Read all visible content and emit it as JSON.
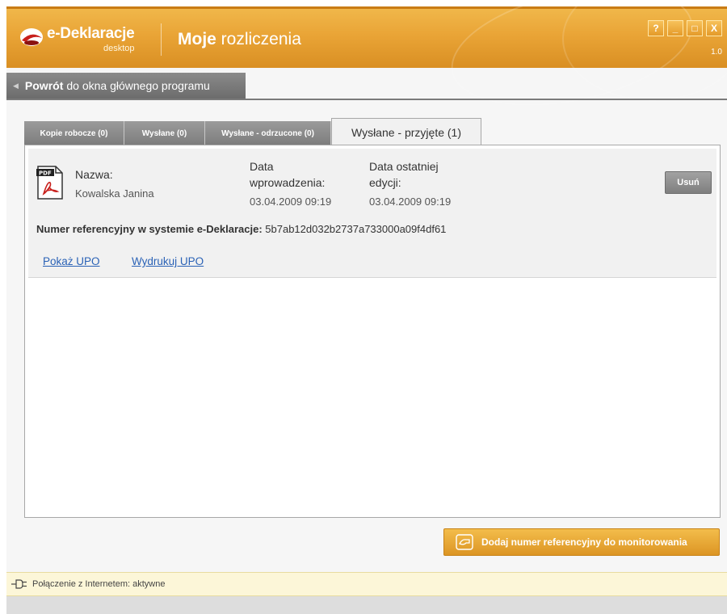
{
  "app": {
    "brand": "e-Deklaracje",
    "brand_sub": "desktop",
    "title_bold": "Moje",
    "title_rest": " rozliczenia",
    "version": "1.0",
    "window_controls": {
      "help": "?",
      "minimize": "_",
      "maximize": "□",
      "close": "X"
    }
  },
  "back": {
    "bold": "Powrót",
    "rest": "do okna głównego programu"
  },
  "tabs": [
    {
      "label": "Kopie robocze (0)",
      "active": false
    },
    {
      "label": "Wysłane (0)",
      "active": false
    },
    {
      "label": "Wysłane - odrzucone (0)",
      "active": false
    },
    {
      "label": "Wysłane - przyjęte (1)",
      "active": true
    }
  ],
  "item": {
    "name_label": "Nazwa:",
    "name_value": "Kowalska Janina",
    "entry_date_label_1": "Data",
    "entry_date_label_2": "wprowadzenia:",
    "entry_date_value": "03.04.2009 09:19",
    "edit_date_label_1": "Data ostatniej",
    "edit_date_label_2": "edycji:",
    "edit_date_value": "03.04.2009 09:19",
    "delete_label": "Usuń",
    "ref_label": "Numer referencyjny w systemie e-Deklaracje:",
    "ref_value": "5b7ab12d032b2737a733000a09f4df61",
    "show_upo": "Pokaż UPO",
    "print_upo": "Wydrukuj UPO",
    "icon": "pdf-icon"
  },
  "actions": {
    "add_reference": "Dodaj numer referencyjny do monitorowania"
  },
  "status": {
    "text": "Połączenie z Internetem: aktywne",
    "icon": "plug-icon"
  },
  "colors": {
    "accent_orange": "#e9a436",
    "tab_gray": "#8a8a8a",
    "link_blue": "#2a62b6",
    "status_bg": "#fcf6d8"
  }
}
